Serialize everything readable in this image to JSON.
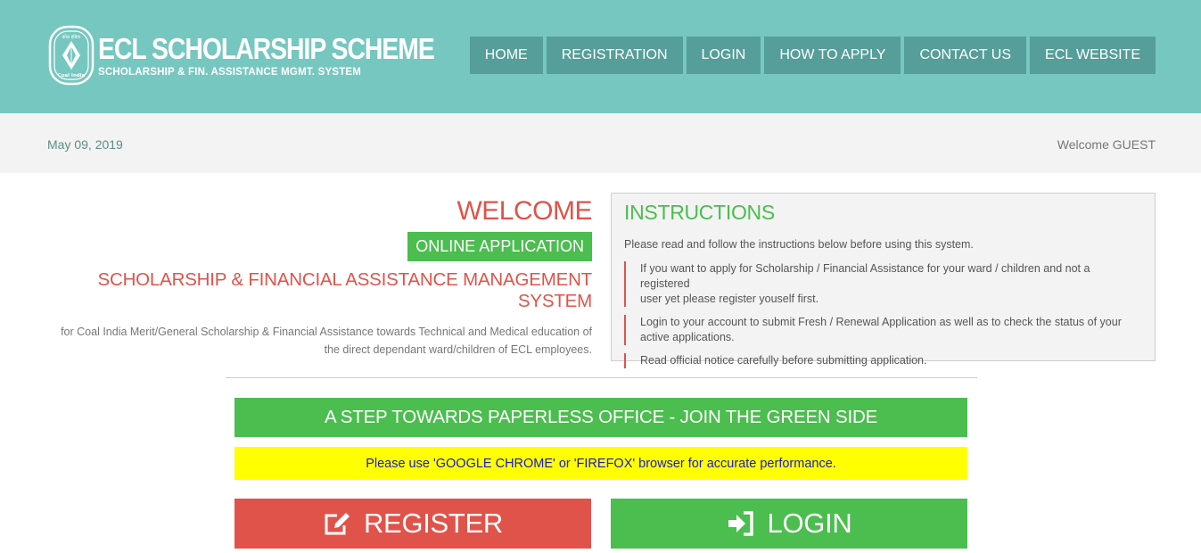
{
  "brand": {
    "title": "ECL SCHOLARSHIP SCHEME",
    "subtitle": "SCHOLARSHIP & FIN. ASSISTANCE MGMT. SYSTEM",
    "emblem_icon": "coal-india-emblem-icon"
  },
  "nav": {
    "items": [
      {
        "label": "HOME"
      },
      {
        "label": "REGISTRATION"
      },
      {
        "label": "LOGIN"
      },
      {
        "label": "HOW TO APPLY"
      },
      {
        "label": "CONTACT US"
      },
      {
        "label": "ECL WEBSITE"
      }
    ]
  },
  "subbar": {
    "date": "May 09, 2019",
    "welcome": "Welcome GUEST"
  },
  "intro": {
    "welcome": "WELCOME",
    "badge": "ONLINE APPLICATION",
    "system_title": "SCHOLARSHIP & FINANCIAL ASSISTANCE MANAGEMENT SYSTEM",
    "description_line1": "for Coal India Merit/General Scholarship & Financial Assistance towards Technical and Medical education of",
    "description_line2": "the direct dependant ward/children of ECL employees."
  },
  "instructions": {
    "title": "INSTRUCTIONS",
    "intro": "Please read and follow the instructions below before using this system.",
    "items": [
      {
        "line1": "If you want to apply for Scholarship / Financial Assistance for your ward / children and not a registered",
        "line2": "user yet please register youself first."
      },
      {
        "line1": "Login to your account to submit Fresh / Renewal Application as well as to check the status of your",
        "line2": "active applications."
      },
      {
        "line1": "Read official notice carefully before submitting application.",
        "line2": ""
      }
    ]
  },
  "banners": {
    "green": "A STEP TOWARDS PAPERLESS OFFICE - JOIN THE GREEN SIDE",
    "yellow": "Please use 'GOOGLE CHROME' or 'FIREFOX' browser for accurate performance."
  },
  "actions": {
    "register_label": "REGISTER",
    "register_icon": "edit-icon",
    "login_label": "LOGIN",
    "login_icon": "sign-in-icon"
  },
  "colors": {
    "header": "#76c7c0",
    "nav": "#569e99",
    "accent_red": "#e0534a",
    "accent_green": "#4cbd4f",
    "notice_yellow": "#ffff00"
  }
}
